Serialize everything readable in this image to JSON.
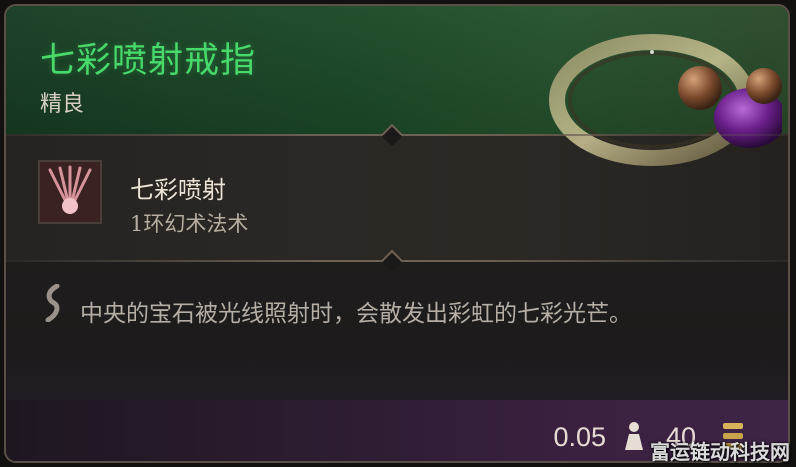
{
  "item": {
    "name": "七彩喷射戒指",
    "rarity": "精良",
    "rarity_color": "#47d96a"
  },
  "spell": {
    "name": "七彩喷射",
    "level": "1环幻术法术",
    "icon": "prismatic-spray-spell-icon"
  },
  "description": {
    "icon": "quill-icon",
    "text": "中央的宝石被光线照射时，会散发出彩虹的七彩光芒。"
  },
  "footer": {
    "weight": "0.05",
    "weight_icon": "weight-icon",
    "value": "40",
    "value_icon": "gold-coin-icon"
  },
  "watermark": "富运链动科技网"
}
